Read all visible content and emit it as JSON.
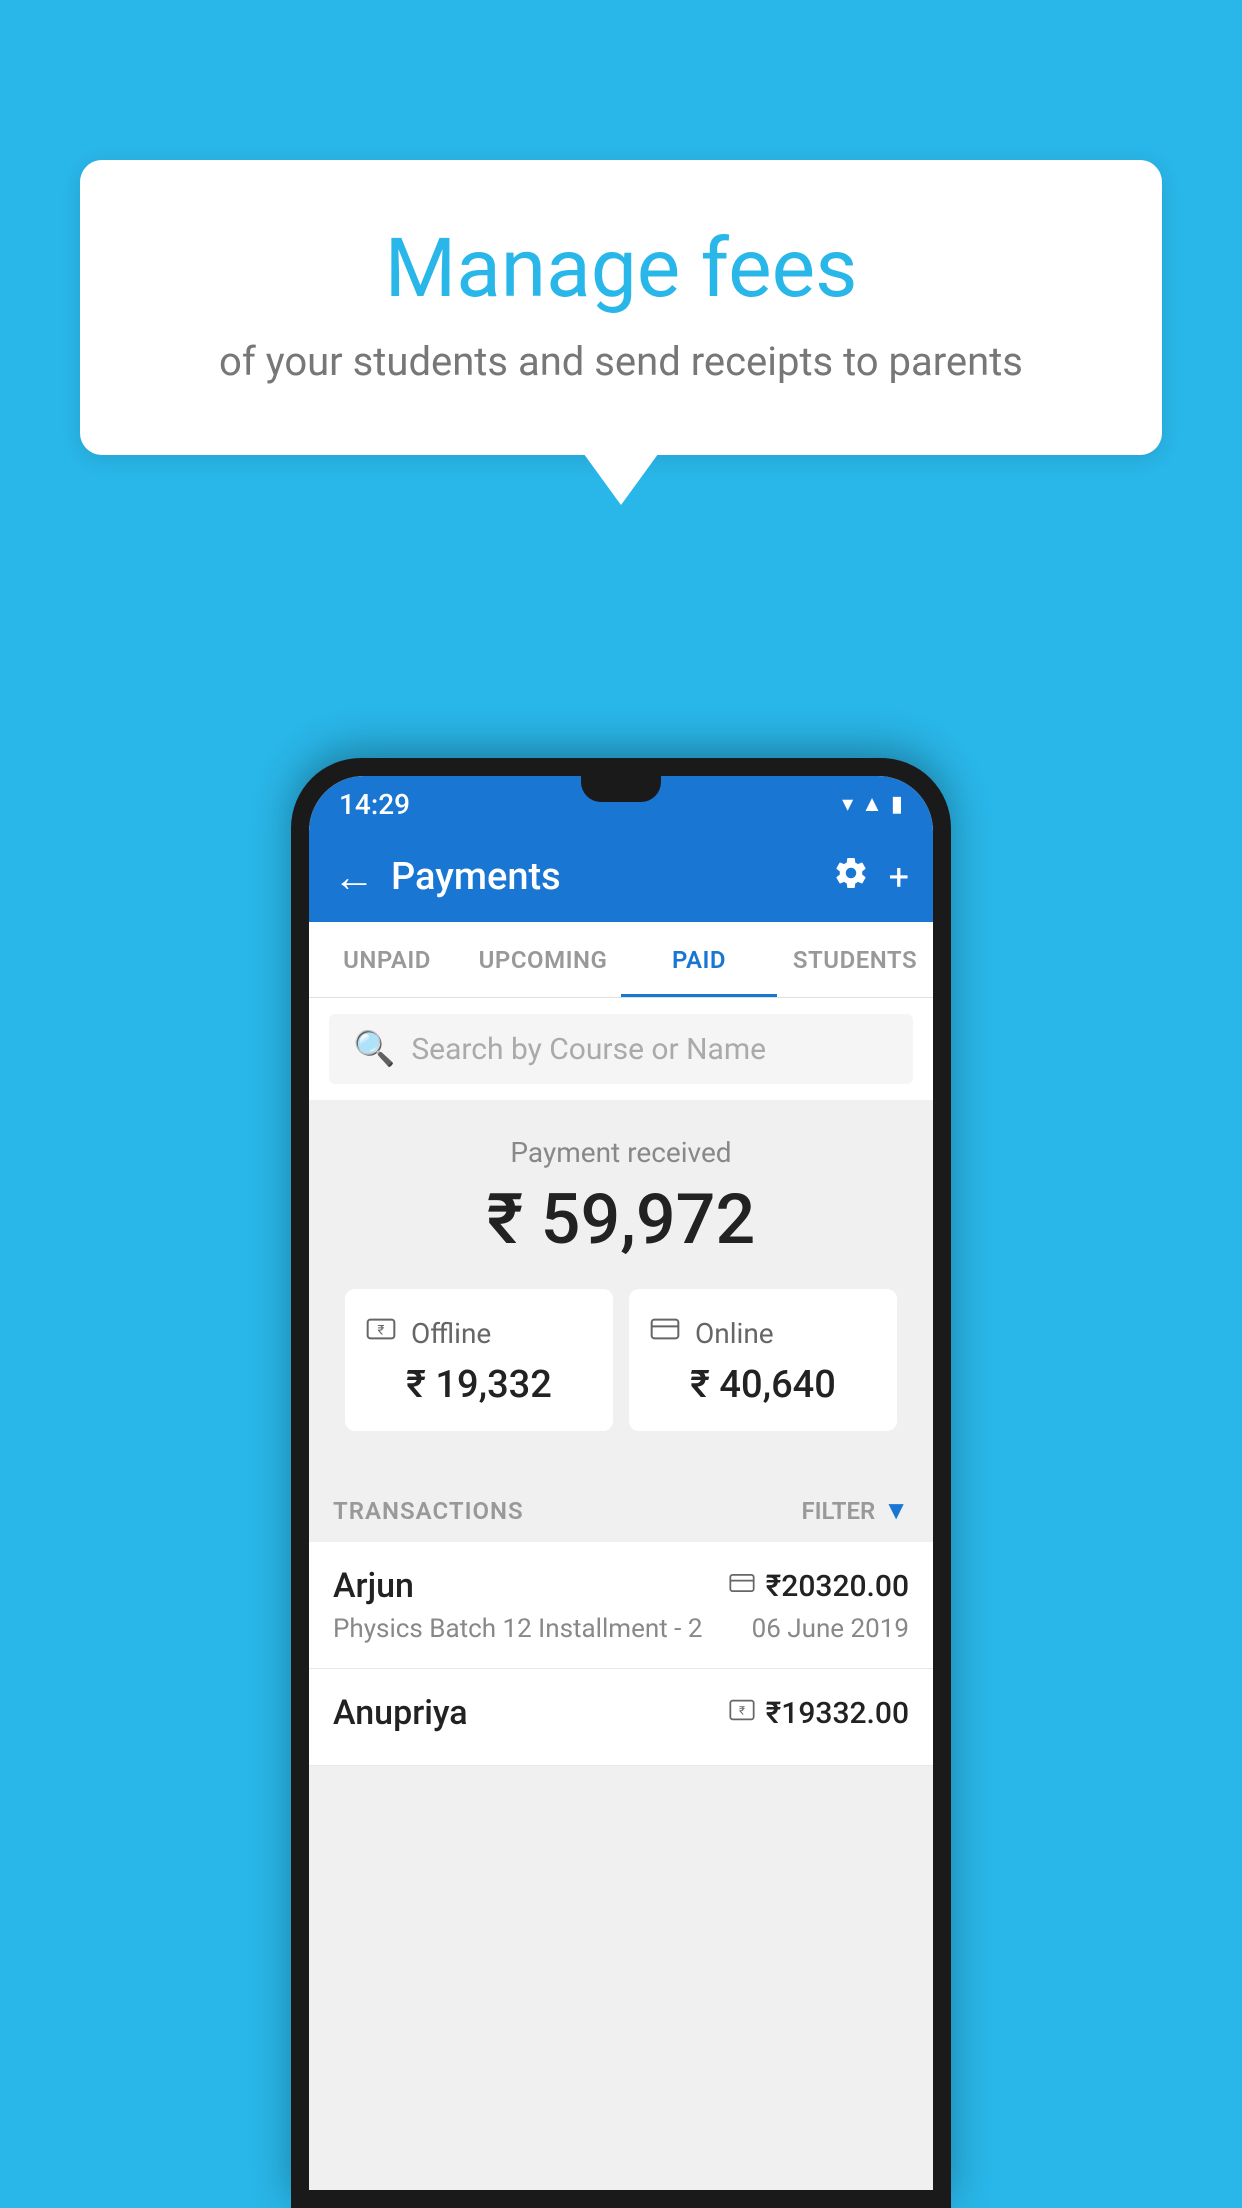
{
  "background_color": "#29B6E8",
  "speech_bubble": {
    "title": "Manage fees",
    "subtitle": "of your students and send receipts to parents"
  },
  "status_bar": {
    "time": "14:29",
    "icons": "▼ ◀ ▮"
  },
  "app_bar": {
    "title": "Payments",
    "back_icon": "←",
    "settings_label": "settings",
    "add_label": "add"
  },
  "tabs": [
    {
      "id": "unpaid",
      "label": "UNPAID",
      "active": false
    },
    {
      "id": "upcoming",
      "label": "UPCOMING",
      "active": false
    },
    {
      "id": "paid",
      "label": "PAID",
      "active": true
    },
    {
      "id": "students",
      "label": "STUDENTS",
      "active": false
    }
  ],
  "search": {
    "placeholder": "Search by Course or Name"
  },
  "payment_summary": {
    "label": "Payment received",
    "total_amount": "₹ 59,972",
    "offline": {
      "label": "Offline",
      "amount": "₹ 19,332"
    },
    "online": {
      "label": "Online",
      "amount": "₹ 40,640"
    }
  },
  "transactions_section": {
    "label": "TRANSACTIONS",
    "filter_label": "FILTER"
  },
  "transactions": [
    {
      "name": "Arjun",
      "amount": "₹20320.00",
      "payment_type": "online",
      "detail": "Physics Batch 12 Installment - 2",
      "date": "06 June 2019"
    },
    {
      "name": "Anupriya",
      "amount": "₹19332.00",
      "payment_type": "offline",
      "detail": "",
      "date": ""
    }
  ]
}
